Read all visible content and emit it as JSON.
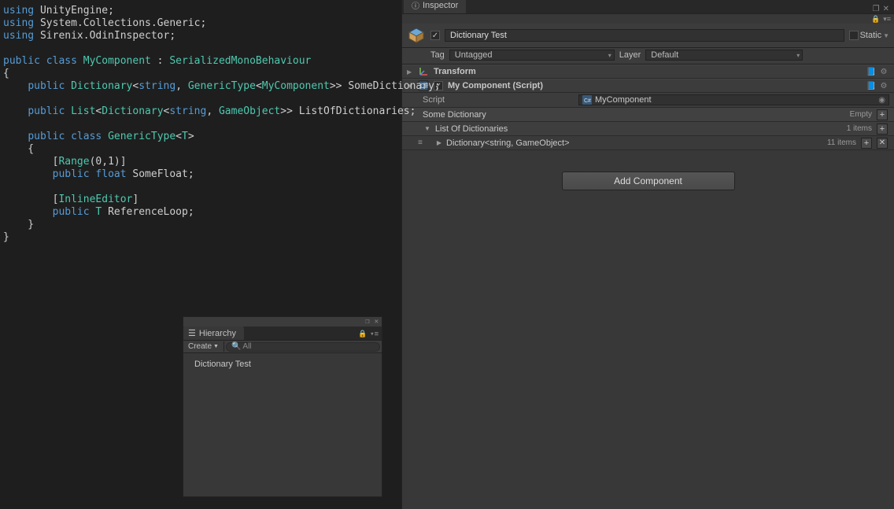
{
  "code": {
    "lines": [
      [
        [
          "kw",
          "using"
        ],
        [
          "pun",
          " "
        ],
        [
          "id",
          "UnityEngine"
        ],
        [
          "pun",
          ";"
        ]
      ],
      [
        [
          "kw",
          "using"
        ],
        [
          "pun",
          " "
        ],
        [
          "id",
          "System.Collections.Generic"
        ],
        [
          "pun",
          ";"
        ]
      ],
      [
        [
          "kw",
          "using"
        ],
        [
          "pun",
          " "
        ],
        [
          "id",
          "Sirenix.OdinInspector"
        ],
        [
          "pun",
          ";"
        ]
      ],
      [
        [
          "pun",
          ""
        ]
      ],
      [
        [
          "kw",
          "public"
        ],
        [
          "pun",
          " "
        ],
        [
          "kw",
          "class"
        ],
        [
          "pun",
          " "
        ],
        [
          "type",
          "MyComponent"
        ],
        [
          "pun",
          " : "
        ],
        [
          "type",
          "SerializedMonoBehaviour"
        ]
      ],
      [
        [
          "pun",
          "{"
        ]
      ],
      [
        [
          "pun",
          "    "
        ],
        [
          "kw",
          "public"
        ],
        [
          "pun",
          " "
        ],
        [
          "type",
          "Dictionary"
        ],
        [
          "pun",
          "<"
        ],
        [
          "kw",
          "string"
        ],
        [
          "pun",
          ", "
        ],
        [
          "type",
          "GenericType"
        ],
        [
          "pun",
          "<"
        ],
        [
          "type",
          "MyComponent"
        ],
        [
          "pun",
          ">> "
        ],
        [
          "id",
          "SomeDictionary"
        ],
        [
          "pun",
          ";"
        ]
      ],
      [
        [
          "pun",
          ""
        ]
      ],
      [
        [
          "pun",
          "    "
        ],
        [
          "kw",
          "public"
        ],
        [
          "pun",
          " "
        ],
        [
          "type",
          "List"
        ],
        [
          "pun",
          "<"
        ],
        [
          "type",
          "Dictionary"
        ],
        [
          "pun",
          "<"
        ],
        [
          "kw",
          "string"
        ],
        [
          "pun",
          ", "
        ],
        [
          "type",
          "GameObject"
        ],
        [
          "pun",
          ">> "
        ],
        [
          "id",
          "ListOfDictionaries"
        ],
        [
          "pun",
          ";"
        ]
      ],
      [
        [
          "pun",
          ""
        ]
      ],
      [
        [
          "pun",
          "    "
        ],
        [
          "kw",
          "public"
        ],
        [
          "pun",
          " "
        ],
        [
          "kw",
          "class"
        ],
        [
          "pun",
          " "
        ],
        [
          "type",
          "GenericType"
        ],
        [
          "pun",
          "<"
        ],
        [
          "type",
          "T"
        ],
        [
          "pun",
          ">"
        ]
      ],
      [
        [
          "pun",
          "    {"
        ]
      ],
      [
        [
          "pun",
          "        ["
        ],
        [
          "type",
          "Range"
        ],
        [
          "pun",
          "(0,1)]"
        ]
      ],
      [
        [
          "pun",
          "        "
        ],
        [
          "kw",
          "public"
        ],
        [
          "pun",
          " "
        ],
        [
          "kw",
          "float"
        ],
        [
          "pun",
          " "
        ],
        [
          "id",
          "SomeFloat"
        ],
        [
          "pun",
          ";"
        ]
      ],
      [
        [
          "pun",
          ""
        ]
      ],
      [
        [
          "pun",
          "        ["
        ],
        [
          "type",
          "InlineEditor"
        ],
        [
          "pun",
          "]"
        ]
      ],
      [
        [
          "pun",
          "        "
        ],
        [
          "kw",
          "public"
        ],
        [
          "pun",
          " "
        ],
        [
          "type",
          "T"
        ],
        [
          "pun",
          " "
        ],
        [
          "id",
          "ReferenceLoop"
        ],
        [
          "pun",
          ";"
        ]
      ],
      [
        [
          "pun",
          "    }"
        ]
      ],
      [
        [
          "pun",
          "}"
        ]
      ]
    ]
  },
  "hierarchy": {
    "tab": "Hierarchy",
    "create": "Create",
    "searchPlaceholder": "All",
    "items": [
      "Dictionary Test"
    ]
  },
  "inspector": {
    "tab": "Inspector",
    "objectName": "Dictionary Test",
    "nameChecked": true,
    "staticLabel": "Static",
    "tagLabel": "Tag",
    "tagValue": "Untagged",
    "layerLabel": "Layer",
    "layerValue": "Default",
    "components": {
      "transform": {
        "title": "Transform"
      },
      "script": {
        "title": "My Component (Script)",
        "scriptLabel": "Script",
        "scriptValue": "MyComponent",
        "someDict": {
          "label": "Some Dictionary",
          "state": "Empty"
        },
        "listOfDict": {
          "label": "List Of Dictionaries",
          "count": "1 items",
          "child": {
            "label": "Dictionary<string, GameObject>",
            "count": "11 items"
          }
        }
      }
    },
    "addComponent": "Add Component"
  }
}
